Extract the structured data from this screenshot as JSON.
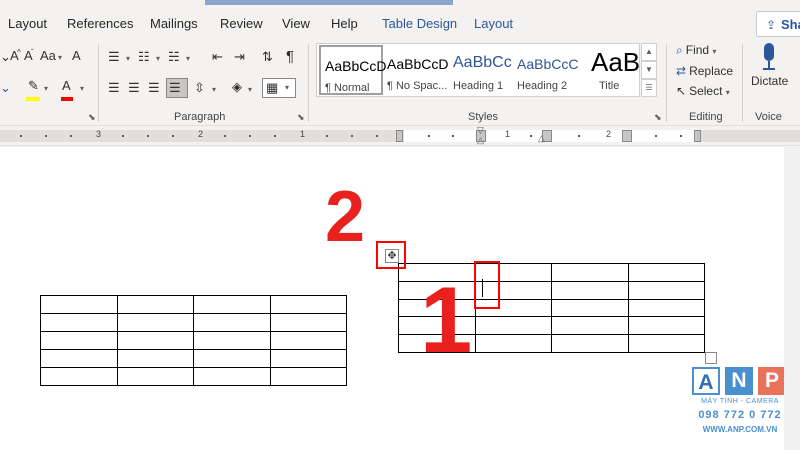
{
  "menu": {
    "items": [
      "Layout",
      "References",
      "Mailings",
      "Review",
      "View",
      "Help",
      "Table Design",
      "Layout"
    ],
    "active_tab_color": "#2b579a",
    "share_label": "Sha"
  },
  "ribbon": {
    "font_icons": {
      "font_size_label": "A",
      "shrink_label": "A",
      "case_label": "Aa",
      "clear_label": "A",
      "font_color_label": "A"
    },
    "groups": {
      "paragraph": "Paragraph",
      "styles": "Styles",
      "editing": "Editing",
      "voice": "Voice"
    },
    "styles": [
      {
        "preview": "AaBbCcDd",
        "name": "¶ Normal"
      },
      {
        "preview": "AaBbCcDd",
        "name": "¶ No Spac..."
      },
      {
        "preview": "AaBbCc",
        "name": "Heading 1"
      },
      {
        "preview": "AaBbCcC",
        "name": "Heading 2"
      },
      {
        "preview": "AaB",
        "name": "Title"
      }
    ],
    "editing": {
      "find": "Find",
      "replace": "Replace",
      "select": "Select"
    },
    "dictate": "Dictate",
    "highlight_color": "#ffff00",
    "font_color_bar": "#ff0000"
  },
  "ruler": {
    "left_numbers": [
      "3",
      "2",
      "1",
      "1",
      "2",
      "3"
    ],
    "right_numbers": [
      "1",
      "1",
      "2"
    ]
  },
  "document": {
    "table1": {
      "rows": 5,
      "cols": 4
    },
    "table2": {
      "rows": 5,
      "cols": 4
    },
    "annotations": {
      "step_1": "1",
      "step_2": "2",
      "color": "#e8201e"
    },
    "move_handle_glyph": "✥"
  },
  "watermark": {
    "letters": [
      "A",
      "N",
      "P"
    ],
    "tagline": "MÁY TÍNH - CAMERA",
    "phone": "098 772 0 772",
    "website": "WWW.ANP.COM.VN"
  }
}
